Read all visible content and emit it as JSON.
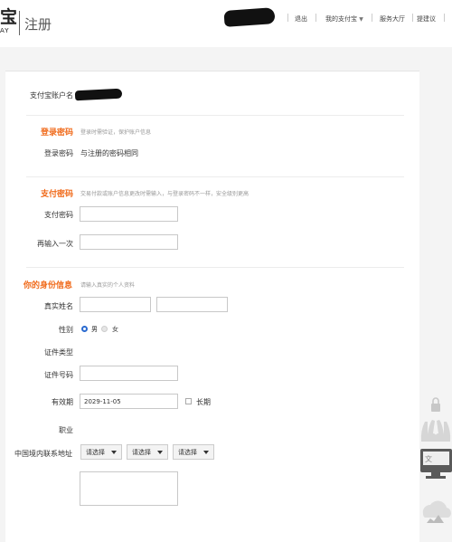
{
  "header": {
    "logo_glyph": "宝",
    "logo_sub": "AY",
    "title": "注册",
    "nav": {
      "logout": "退出",
      "my_alipay": "我的支付宝",
      "service_hall": "服务大厅",
      "suggest": "提建议"
    }
  },
  "account": {
    "label": "支付宝账户名"
  },
  "login_password": {
    "title": "登录密码",
    "hint": "登录时需验证，保护账户信息",
    "label": "登录密码",
    "value": "与注册的密码相同"
  },
  "pay_password": {
    "title": "支付密码",
    "hint": "交易付款或账户信息更改时需输入，与登录密码不一样，安全级别更高",
    "label": "支付密码",
    "confirm_label": "再输入一次"
  },
  "identity": {
    "title": "你的身份信息",
    "hint": "请输入真实的个人资料",
    "name_label": "真实姓名",
    "gender_label": "性别",
    "male": "男",
    "female": "女",
    "id_type_label": "证件类型",
    "id_number_label": "证件号码",
    "validity_label": "有效期",
    "validity_value": "2029-11-05",
    "longterm_label": "长期",
    "occupation_label": "职业",
    "address_label": "中国境内联系地址",
    "select_placeholder": "请选择",
    "selected_gender": "男",
    "longterm_checked": false
  },
  "colors": {
    "accent": "#f06a1a",
    "radio_selected": "#2a6ad0"
  }
}
